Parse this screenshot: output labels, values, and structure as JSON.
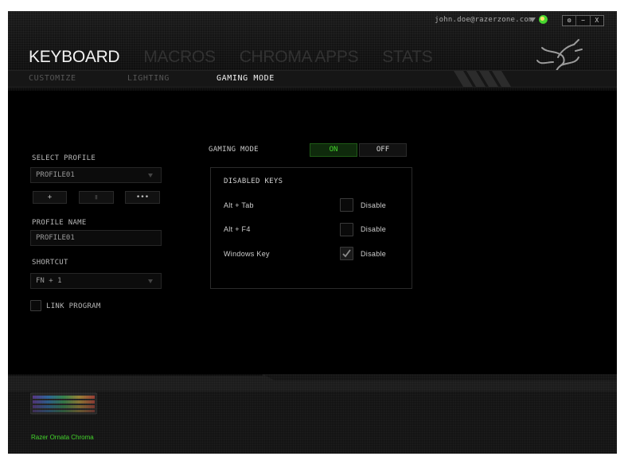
{
  "account": {
    "email": "john.doe@razerzone.com"
  },
  "window_buttons": [
    "⚙",
    "−",
    "X"
  ],
  "main_tabs": [
    "KEYBOARD",
    "MACROS",
    "CHROMA APPS",
    "STATS"
  ],
  "sub_tabs": [
    "CUSTOMIZE",
    "LIGHTING",
    "GAMING MODE"
  ],
  "profile": {
    "select_label": "SELECT PROFILE",
    "selected": "PROFILE01",
    "buttons": {
      "add": "+",
      "delete": "▮",
      "more": "•••"
    },
    "name_label": "PROFILE NAME",
    "name_value": "PROFILE01",
    "shortcut_label": "SHORTCUT",
    "shortcut_value": "FN + 1",
    "link_program_label": "LINK PROGRAM",
    "link_program_checked": false
  },
  "gaming_mode": {
    "label": "GAMING MODE",
    "on_label": "ON",
    "off_label": "OFF",
    "state": "on",
    "disabled_keys_title": "DISABLED KEYS",
    "keys": [
      {
        "name": "Alt + Tab",
        "action": "Disable",
        "checked": false
      },
      {
        "name": "Alt + F4",
        "action": "Disable",
        "checked": false
      },
      {
        "name": "Windows Key",
        "action": "Disable",
        "checked": true
      }
    ]
  },
  "device": {
    "name": "Razer Ornata Chroma"
  },
  "colors": {
    "accent": "#44d62c",
    "background": "#000000"
  }
}
